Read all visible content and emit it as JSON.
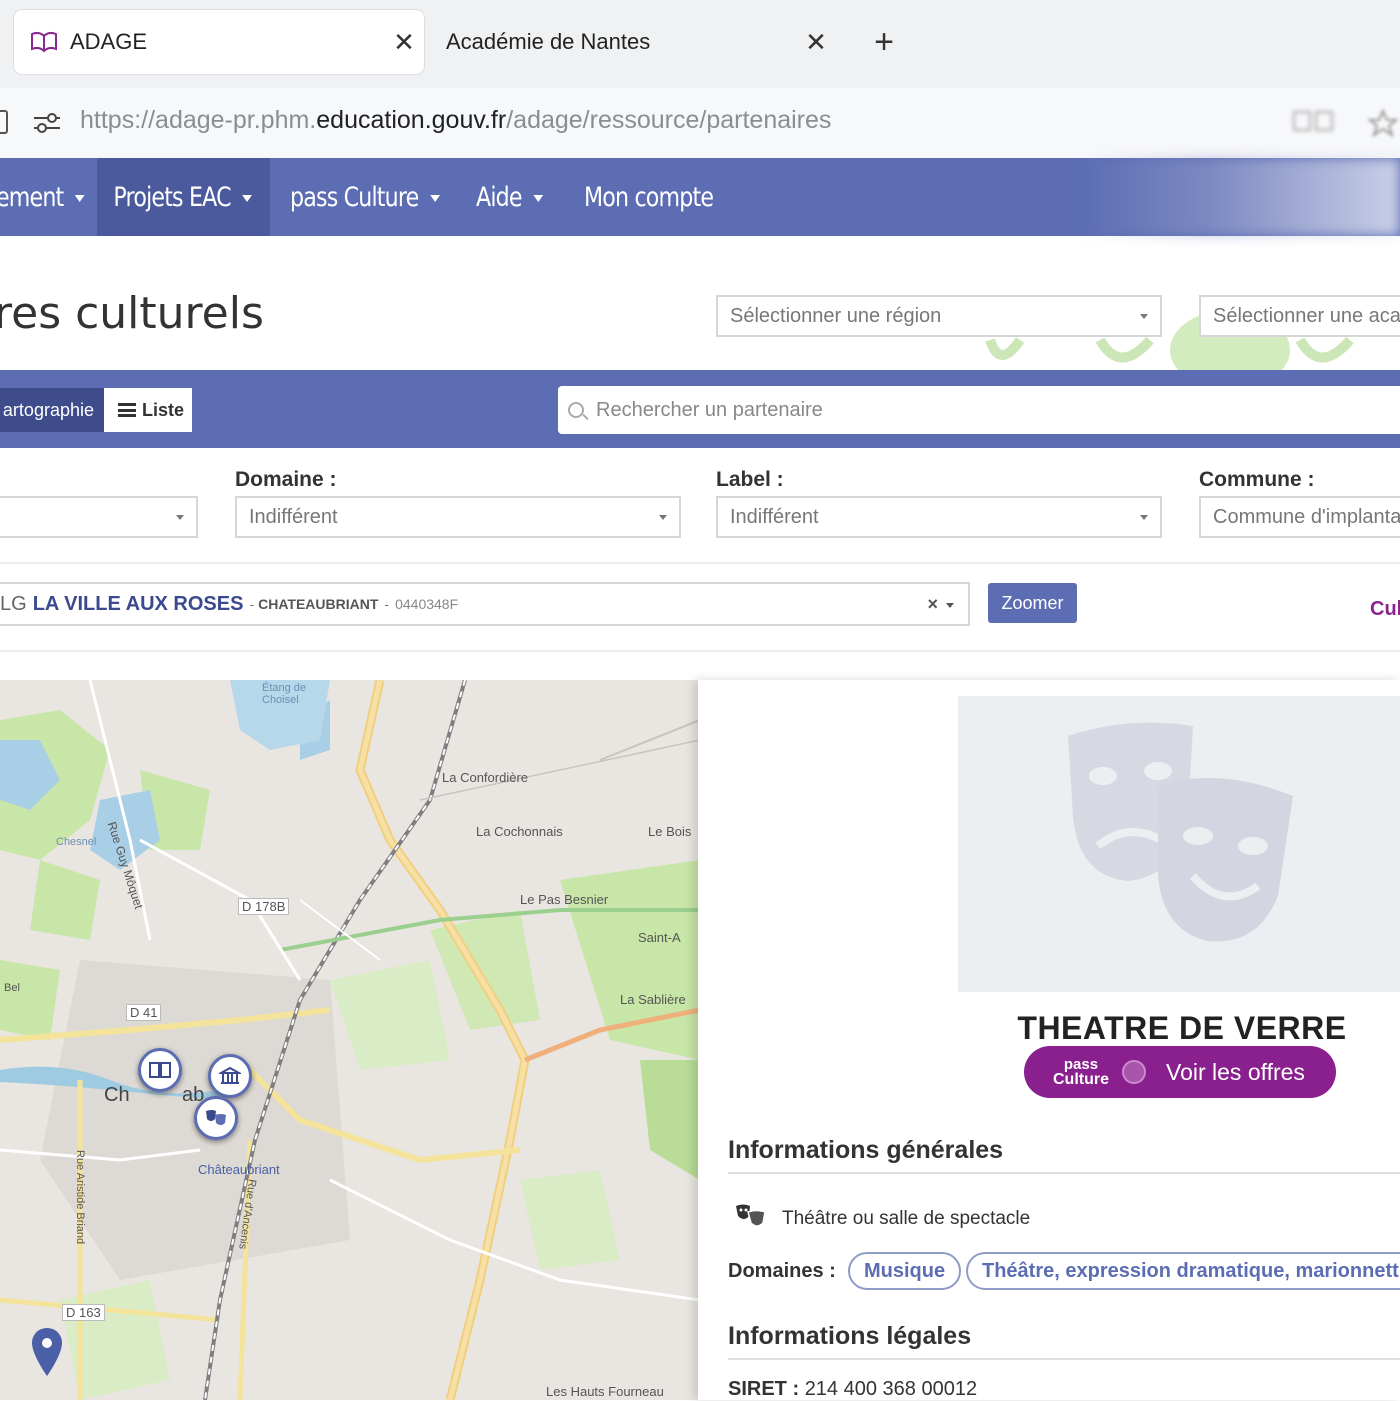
{
  "browser": {
    "tabs": [
      {
        "title": "ADAGE",
        "icon": "adage-book-icon",
        "active": true
      },
      {
        "title": "Académie de Nantes",
        "active": false
      }
    ],
    "url_prefix": "https://adage-pr.phm.",
    "url_host": "education.gouv.fr",
    "url_path": "/adage/ressource/partenaires"
  },
  "nav": {
    "items": [
      "ement",
      "Projets EAC",
      "pass Culture",
      "Aide",
      "Mon compte"
    ]
  },
  "page": {
    "title": "res culturels",
    "region_placeholder": "Sélectionner une région",
    "academie_placeholder": "Sélectionner une aca"
  },
  "view_toggle": {
    "map_label": "artographie",
    "list_label": "Liste"
  },
  "search": {
    "placeholder": "Rechercher un partenaire"
  },
  "filters": {
    "domaine_label": "Domaine :",
    "domaine_value": "Indifférent",
    "label_label": "Label :",
    "label_value": "Indifférent",
    "commune_label": "Commune :",
    "commune_value": "Commune d'implanta"
  },
  "selected_partner": {
    "prefix": "LG",
    "name": "LA VILLE AUX ROSES",
    "city": "CHATEAUBRIANT",
    "separator": "-",
    "uai": "0440348F",
    "clear": "×",
    "zoom_label": "Zoomer",
    "pass_logo_cut": "Cul"
  },
  "map": {
    "labels": [
      "La Confordière",
      "La Cochonnais",
      "Le Bois",
      "Le Pas Besnier",
      "Saint-A",
      "La Sablière",
      "D 178B",
      "D 41",
      "Ch",
      "ab",
      "Châteaubriant",
      "D 163",
      "Les Hauts Fourneau",
      "Rue Guy Môquet",
      "Rue Aristide Briand",
      "Rue d'Ancenis",
      "Étang de Choisel",
      "Chesnel",
      "Bel"
    ]
  },
  "detail": {
    "title": "THEATRE DE VERRE",
    "offers_logo_line1": "pass",
    "offers_logo_line2": "Culture",
    "offers_label": "Voir les offres",
    "general_heading": "Informations générales",
    "category": "Théâtre ou salle de spectacle",
    "domaines_label": "Domaines :",
    "domaines": [
      "Musique",
      "Théâtre, expression dramatique, marionnett"
    ],
    "legal_heading": "Informations légales",
    "siret_label": "SIRET :",
    "siret_value": "214 400 368 00012"
  },
  "colors": {
    "primary": "#5c6db3",
    "primary_dark": "#3e4c8c",
    "pass_culture": "#8a1f8e",
    "map_bg": "#e9e6e1"
  }
}
